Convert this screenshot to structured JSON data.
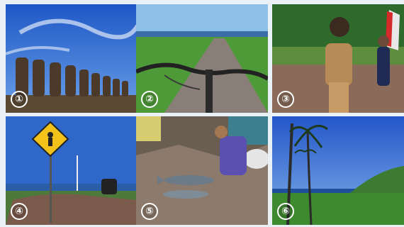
{
  "photos": [
    {
      "label": "①"
    },
    {
      "label": "②"
    },
    {
      "label": "③"
    },
    {
      "label": "④"
    },
    {
      "label": "⑤"
    },
    {
      "label": "⑥"
    }
  ],
  "colors": {
    "sky": "#2f6fd0",
    "grass": "#3d8a2c",
    "road": "#8a7f78",
    "sign": "#f2c21b"
  }
}
